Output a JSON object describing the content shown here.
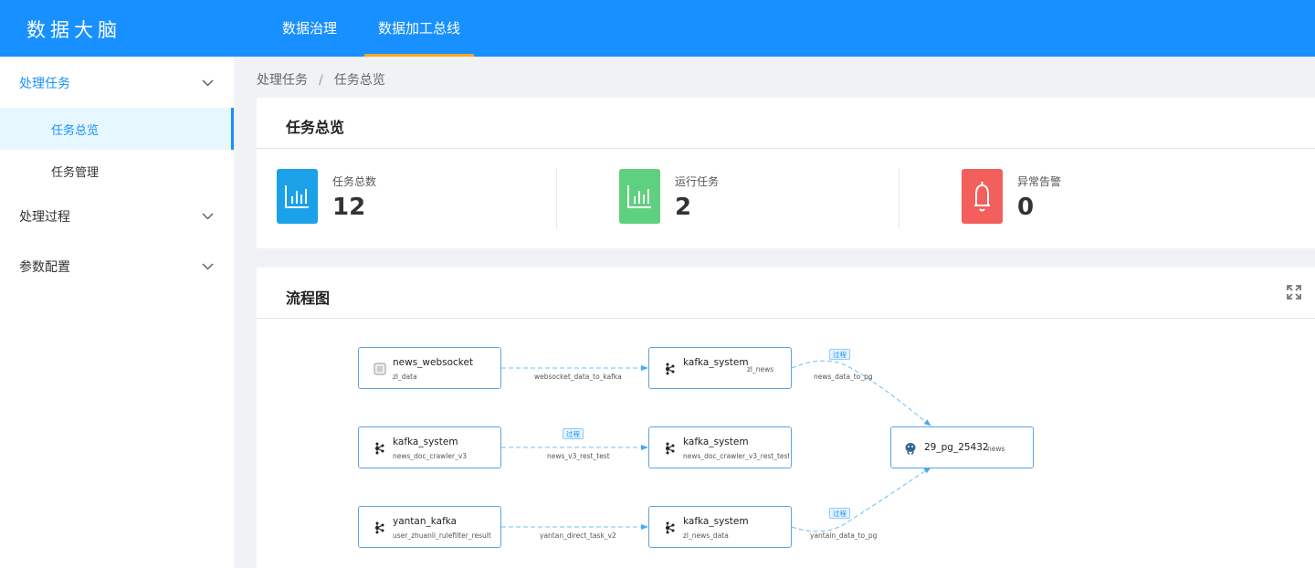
{
  "header": {
    "brand": "数据大脑",
    "nav": [
      {
        "label": "数据治理",
        "active": false
      },
      {
        "label": "数据加工总线",
        "active": true
      }
    ]
  },
  "sidebar": {
    "groups": [
      {
        "label": "处理任务",
        "open": true,
        "items": [
          {
            "label": "任务总览",
            "active": true
          },
          {
            "label": "任务管理",
            "active": false
          }
        ]
      },
      {
        "label": "处理过程",
        "open": false
      },
      {
        "label": "参数配置",
        "open": false
      }
    ]
  },
  "breadcrumb": {
    "items": [
      "处理任务",
      "任务总览"
    ],
    "separator": "/"
  },
  "overview": {
    "title": "任务总览",
    "stats": [
      {
        "label": "任务总数",
        "value": "12",
        "color": "#1aa1e8",
        "icon": "bar-chart-icon"
      },
      {
        "label": "运行任务",
        "value": "2",
        "color": "#5fcf80",
        "icon": "bar-chart-icon"
      },
      {
        "label": "异常告警",
        "value": "0",
        "color": "#f25f5c",
        "icon": "bell-icon"
      }
    ]
  },
  "flow": {
    "title": "流程图",
    "nodes": [
      {
        "title": "news_websocket",
        "subtitle": "zl_data",
        "tag": "",
        "icon": "websocket-icon"
      },
      {
        "title": "kafka_system",
        "subtitle": "",
        "tag": "zl_news",
        "icon": "kafka-icon"
      },
      {
        "title": "kafka_system",
        "subtitle": "news_doc_crawler_v3",
        "tag": "",
        "icon": "kafka-icon"
      },
      {
        "title": "kafka_system",
        "subtitle": "news_doc_crawler_v3_rest_test",
        "tag": "",
        "icon": "kafka-icon"
      },
      {
        "title": "yantan_kafka",
        "subtitle": "user_zhuanli_rulefilter_result",
        "tag": "",
        "icon": "kafka-icon"
      },
      {
        "title": "kafka_system",
        "subtitle": "zl_news_data",
        "tag": "",
        "icon": "kafka-icon"
      },
      {
        "title": "29_pg_25432",
        "subtitle": "",
        "tag": "news",
        "icon": "postgresql-icon"
      }
    ],
    "edges": [
      {
        "label": "websocket_data_to_kafka",
        "tag": ""
      },
      {
        "label": "news_data_to_pg",
        "tag": "过程"
      },
      {
        "label": "news_v3_rest_test",
        "tag": "过程"
      },
      {
        "label": "yantan_direct_task_v2",
        "tag": ""
      },
      {
        "label": "yantain_data_to_pg",
        "tag": "过程"
      }
    ]
  }
}
